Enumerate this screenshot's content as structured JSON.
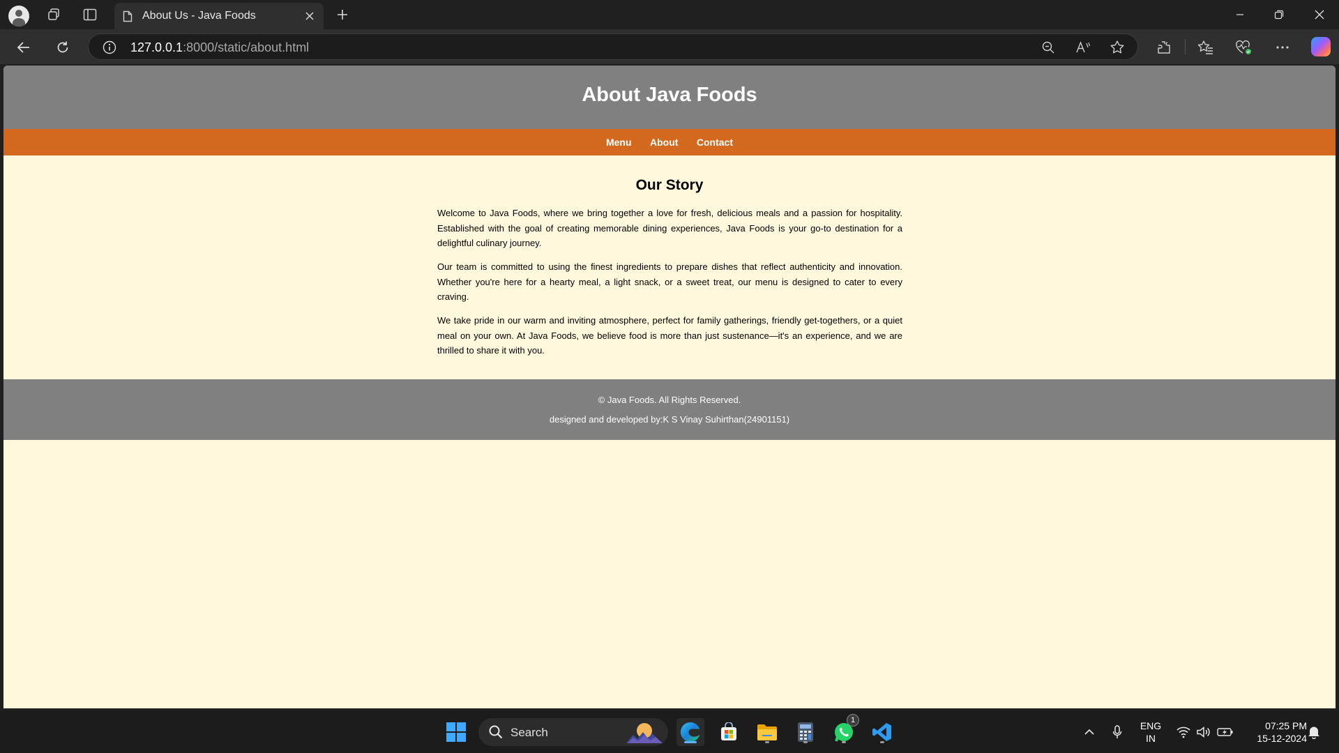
{
  "browser": {
    "tab_title": "About Us - Java Foods",
    "url_host": "127.0.0.1",
    "url_path": ":8000/static/about.html"
  },
  "page": {
    "header_title": "About Java Foods",
    "nav": [
      "Menu",
      "About",
      "Contact"
    ],
    "section_title": "Our Story",
    "paragraphs": [
      "Welcome to Java Foods, where we bring together a love for fresh, delicious meals and a passion for hospitality. Established with the goal of creating memorable dining experiences, Java Foods is your go-to destination for a delightful culinary journey.",
      "Our team is committed to using the finest ingredients to prepare dishes that reflect authenticity and innovation. Whether you're here for a hearty meal, a light snack, or a sweet treat, our menu is designed to cater to every craving.",
      "We take pride in our warm and inviting atmosphere, perfect for family gatherings, friendly get-togethers, or a quiet meal on your own. At Java Foods, we believe food is more than just sustenance—it's an experience, and we are thrilled to share it with you."
    ],
    "footer_copyright": "© Java Foods. All Rights Reserved.",
    "footer_credit": "designed and developed by:K S Vinay Suhirthan(24901151)"
  },
  "taskbar": {
    "search_label": "Search",
    "whatsapp_badge": "1",
    "lang_line1": "ENG",
    "lang_line2": "IN",
    "time": "07:25 PM",
    "date": "15-12-2024"
  },
  "colors": {
    "header_bg": "#808080",
    "nav_bg": "#d2691e",
    "page_bg": "#fff8dc"
  }
}
